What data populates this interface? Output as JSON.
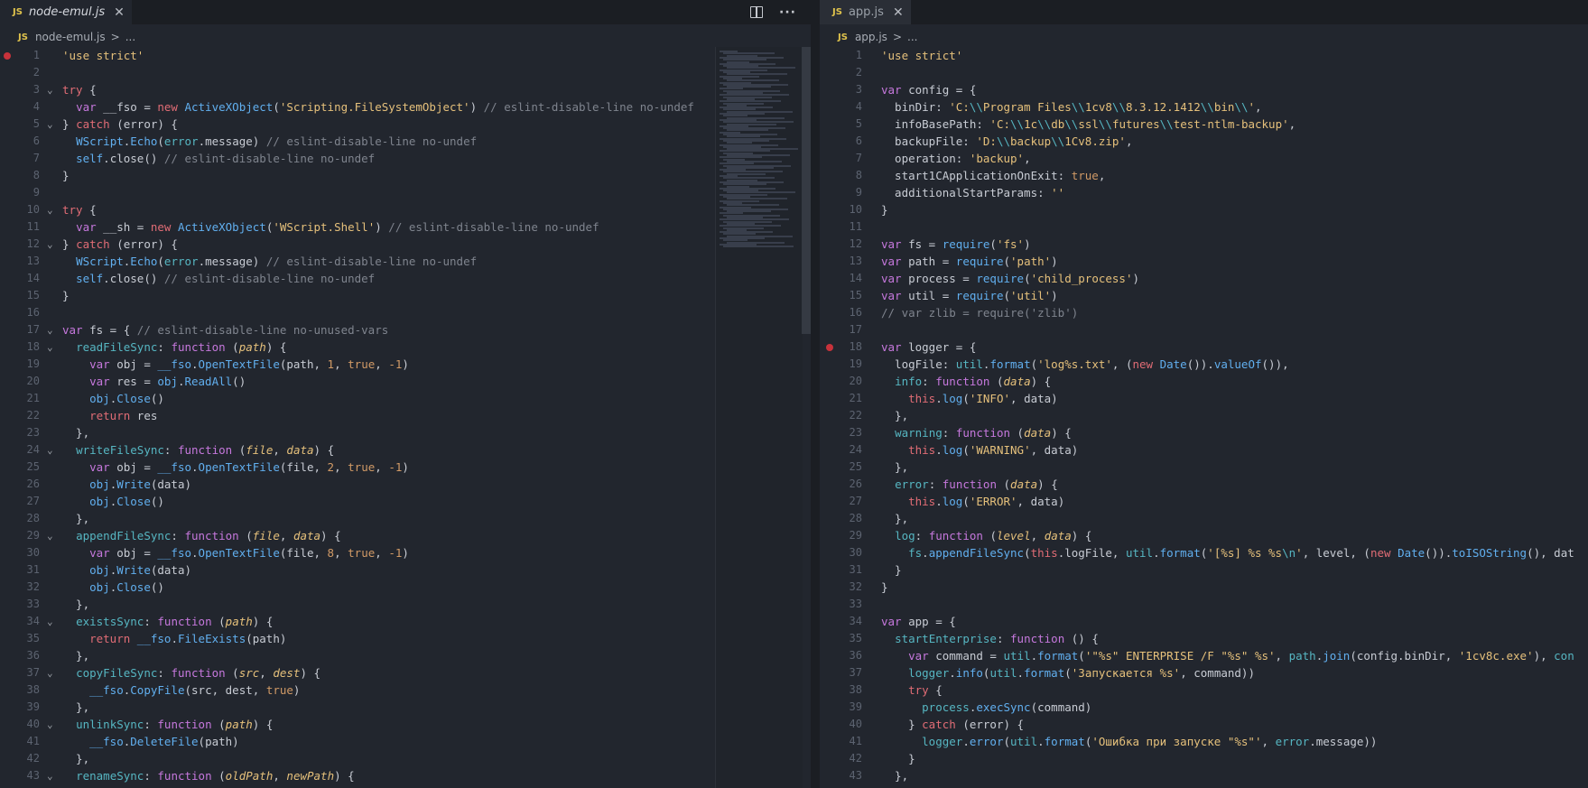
{
  "left": {
    "tab": {
      "badge": "JS",
      "name": "node-emul.js",
      "close": "✕"
    },
    "actions": {
      "more": "···"
    },
    "breadcrumb": {
      "badge": "JS",
      "file": "node-emul.js",
      "sep": ">",
      "rest": "..."
    }
  },
  "right": {
    "tab": {
      "badge": "JS",
      "name": "app.js",
      "close": "✕"
    },
    "breadcrumb": {
      "badge": "JS",
      "file": "app.js",
      "sep": ">",
      "rest": "..."
    }
  },
  "colors": {
    "breakpoint": "#c8323b",
    "accent_js": "#e0c34c",
    "background": "#22262e"
  },
  "left_lines": [
    {
      "n": "1",
      "bp": true,
      "h": "<span class='s'>'use strict'</span>"
    },
    {
      "n": "2",
      "h": ""
    },
    {
      "n": "3",
      "fold": true,
      "h": "<span class='kr'>try</span> {"
    },
    {
      "n": "4",
      "h": "  <span class='k'>var</span> __fso = <span class='kr'>new</span> <span class='f'>ActiveXObject</span>(<span class='s'>'Scripting.FileSystemObject'</span>) <span class='c'>// eslint-disable-line no-undef</span>"
    },
    {
      "n": "5",
      "fold": true,
      "h": "} <span class='kr'>catch</span> (error) {"
    },
    {
      "n": "6",
      "h": "  <span class='f'>WScript</span>.<span class='f'>Echo</span>(<span class='cy'>error</span>.message) <span class='c'>// eslint-disable-line no-undef</span>"
    },
    {
      "n": "7",
      "h": "  <span class='f'>self</span>.close() <span class='c'>// eslint-disable-line no-undef</span>"
    },
    {
      "n": "8",
      "h": "}"
    },
    {
      "n": "9",
      "h": ""
    },
    {
      "n": "10",
      "fold": true,
      "h": "<span class='kr'>try</span> {"
    },
    {
      "n": "11",
      "h": "  <span class='k'>var</span> __sh = <span class='kr'>new</span> <span class='f'>ActiveXObject</span>(<span class='s'>'WScript.Shell'</span>) <span class='c'>// eslint-disable-line no-undef</span>"
    },
    {
      "n": "12",
      "fold": true,
      "h": "} <span class='kr'>catch</span> (error) {"
    },
    {
      "n": "13",
      "h": "  <span class='f'>WScript</span>.<span class='f'>Echo</span>(<span class='cy'>error</span>.message) <span class='c'>// eslint-disable-line no-undef</span>"
    },
    {
      "n": "14",
      "h": "  <span class='f'>self</span>.close() <span class='c'>// eslint-disable-line no-undef</span>"
    },
    {
      "n": "15",
      "h": "}"
    },
    {
      "n": "16",
      "h": ""
    },
    {
      "n": "17",
      "fold": true,
      "h": "<span class='k'>var</span> fs = { <span class='c'>// eslint-disable-line no-unused-vars</span>"
    },
    {
      "n": "18",
      "fold": true,
      "h": "  <span class='cy'>readFileSync</span>: <span class='k'>function</span> (<span class='p'>path</span>) {"
    },
    {
      "n": "19",
      "h": "    <span class='k'>var</span> obj = <span class='f'>__fso</span>.<span class='f'>OpenTextFile</span>(path, <span class='n'>1</span>, <span class='n'>true</span>, <span class='n'>-1</span>)"
    },
    {
      "n": "20",
      "h": "    <span class='k'>var</span> res = <span class='f'>obj</span>.<span class='f'>ReadAll</span>()"
    },
    {
      "n": "21",
      "h": "    <span class='f'>obj</span>.<span class='f'>Close</span>()"
    },
    {
      "n": "22",
      "h": "    <span class='kr'>return</span> res"
    },
    {
      "n": "23",
      "h": "  },"
    },
    {
      "n": "24",
      "fold": true,
      "h": "  <span class='cy'>writeFileSync</span>: <span class='k'>function</span> (<span class='p'>file</span>, <span class='p'>data</span>) {"
    },
    {
      "n": "25",
      "h": "    <span class='k'>var</span> obj = <span class='f'>__fso</span>.<span class='f'>OpenTextFile</span>(file, <span class='n'>2</span>, <span class='n'>true</span>, <span class='n'>-1</span>)"
    },
    {
      "n": "26",
      "h": "    <span class='f'>obj</span>.<span class='f'>Write</span>(data)"
    },
    {
      "n": "27",
      "h": "    <span class='f'>obj</span>.<span class='f'>Close</span>()"
    },
    {
      "n": "28",
      "h": "  },"
    },
    {
      "n": "29",
      "fold": true,
      "h": "  <span class='cy'>appendFileSync</span>: <span class='k'>function</span> (<span class='p'>file</span>, <span class='p'>data</span>) {"
    },
    {
      "n": "30",
      "h": "    <span class='k'>var</span> obj = <span class='f'>__fso</span>.<span class='f'>OpenTextFile</span>(file, <span class='n'>8</span>, <span class='n'>true</span>, <span class='n'>-1</span>)"
    },
    {
      "n": "31",
      "h": "    <span class='f'>obj</span>.<span class='f'>Write</span>(data)"
    },
    {
      "n": "32",
      "h": "    <span class='f'>obj</span>.<span class='f'>Close</span>()"
    },
    {
      "n": "33",
      "h": "  },"
    },
    {
      "n": "34",
      "fold": true,
      "h": "  <span class='cy'>existsSync</span>: <span class='k'>function</span> (<span class='p'>path</span>) {"
    },
    {
      "n": "35",
      "h": "    <span class='kr'>return</span> <span class='f'>__fso</span>.<span class='f'>FileExists</span>(path)"
    },
    {
      "n": "36",
      "h": "  },"
    },
    {
      "n": "37",
      "fold": true,
      "h": "  <span class='cy'>copyFileSync</span>: <span class='k'>function</span> (<span class='p'>src</span>, <span class='p'>dest</span>) {"
    },
    {
      "n": "38",
      "h": "    <span class='f'>__fso</span>.<span class='f'>CopyFile</span>(src, dest, <span class='n'>true</span>)"
    },
    {
      "n": "39",
      "h": "  },"
    },
    {
      "n": "40",
      "fold": true,
      "h": "  <span class='cy'>unlinkSync</span>: <span class='k'>function</span> (<span class='p'>path</span>) {"
    },
    {
      "n": "41",
      "h": "    <span class='f'>__fso</span>.<span class='f'>DeleteFile</span>(path)"
    },
    {
      "n": "42",
      "h": "  },"
    },
    {
      "n": "43",
      "fold": true,
      "h": "  <span class='cy'>renameSync</span>: <span class='k'>function</span> (<span class='p'>oldPath</span>, <span class='p'>newPath</span>) {"
    }
  ],
  "right_lines": [
    {
      "n": "1",
      "h": "<span class='s'>'use strict'</span>"
    },
    {
      "n": "2",
      "h": ""
    },
    {
      "n": "3",
      "h": "<span class='k'>var</span> config = {"
    },
    {
      "n": "4",
      "h": "  binDir: <span class='s'>'C:</span><span class='cy'>\\\\</span><span class='s'>Program Files</span><span class='cy'>\\\\</span><span class='s'>1cv8</span><span class='cy'>\\\\</span><span class='s'>8.3.12.1412</span><span class='cy'>\\\\</span><span class='s'>bin</span><span class='cy'>\\\\</span><span class='s'>'</span>,"
    },
    {
      "n": "5",
      "h": "  infoBasePath: <span class='s'>'C:</span><span class='cy'>\\\\</span><span class='s'>1c</span><span class='cy'>\\\\</span><span class='s'>db</span><span class='cy'>\\\\</span><span class='s'>ssl</span><span class='cy'>\\\\</span><span class='s'>futures</span><span class='cy'>\\\\</span><span class='s'>test-ntlm-backup'</span>,"
    },
    {
      "n": "6",
      "h": "  backupFile: <span class='s'>'D:</span><span class='cy'>\\\\</span><span class='s'>backup</span><span class='cy'>\\\\</span><span class='s'>1Cv8.zip'</span>,"
    },
    {
      "n": "7",
      "h": "  operation: <span class='s'>'backup'</span>,"
    },
    {
      "n": "8",
      "h": "  start1CApplicationOnExit: <span class='n'>true</span>,"
    },
    {
      "n": "9",
      "h": "  additionalStartParams: <span class='s'>''</span>"
    },
    {
      "n": "10",
      "h": "}"
    },
    {
      "n": "11",
      "h": ""
    },
    {
      "n": "12",
      "h": "<span class='k'>var</span> fs = <span class='f'>require</span>(<span class='s'>'fs'</span>)"
    },
    {
      "n": "13",
      "h": "<span class='k'>var</span> path = <span class='f'>require</span>(<span class='s'>'path'</span>)"
    },
    {
      "n": "14",
      "h": "<span class='k'>var</span> process = <span class='f'>require</span>(<span class='s'>'child_process'</span>)"
    },
    {
      "n": "15",
      "h": "<span class='k'>var</span> util = <span class='f'>require</span>(<span class='s'>'util'</span>)"
    },
    {
      "n": "16",
      "h": "<span class='c'>// var zlib = require('zlib')</span>"
    },
    {
      "n": "17",
      "h": ""
    },
    {
      "n": "18",
      "bp": true,
      "h": "<span class='k'>var</span> logger = {"
    },
    {
      "n": "19",
      "h": "  logFile: <span class='cy'>util</span>.<span class='f'>format</span>(<span class='s'>'log%s.txt'</span>, (<span class='kr'>new</span> <span class='f'>Date</span>()).<span class='f'>valueOf</span>()),"
    },
    {
      "n": "20",
      "h": "  <span class='cy'>info</span>: <span class='k'>function</span> (<span class='p'>data</span>) {"
    },
    {
      "n": "21",
      "h": "    <span class='kr'>this</span>.<span class='f'>log</span>(<span class='s'>'INFO'</span>, data)"
    },
    {
      "n": "22",
      "h": "  },"
    },
    {
      "n": "23",
      "h": "  <span class='cy'>warning</span>: <span class='k'>function</span> (<span class='p'>data</span>) {"
    },
    {
      "n": "24",
      "h": "    <span class='kr'>this</span>.<span class='f'>log</span>(<span class='s'>'WARNING'</span>, data)"
    },
    {
      "n": "25",
      "h": "  },"
    },
    {
      "n": "26",
      "h": "  <span class='cy'>error</span>: <span class='k'>function</span> (<span class='p'>data</span>) {"
    },
    {
      "n": "27",
      "h": "    <span class='kr'>this</span>.<span class='f'>log</span>(<span class='s'>'ERROR'</span>, data)"
    },
    {
      "n": "28",
      "h": "  },"
    },
    {
      "n": "29",
      "h": "  <span class='cy'>log</span>: <span class='k'>function</span> (<span class='p'>level</span>, <span class='p'>data</span>) {"
    },
    {
      "n": "30",
      "h": "    <span class='cy'>fs</span>.<span class='f'>appendFileSync</span>(<span class='kr'>this</span>.logFile, <span class='cy'>util</span>.<span class='f'>format</span>(<span class='s'>'[%s] %s %s</span><span class='cy'>\\n</span><span class='s'>'</span>, level, (<span class='kr'>new</span> <span class='f'>Date</span>()).<span class='f'>toISOString</span>(), dat"
    },
    {
      "n": "31",
      "h": "  }"
    },
    {
      "n": "32",
      "h": "}"
    },
    {
      "n": "33",
      "h": ""
    },
    {
      "n": "34",
      "h": "<span class='k'>var</span> app = {"
    },
    {
      "n": "35",
      "h": "  <span class='cy'>startEnterprise</span>: <span class='k'>function</span> () {"
    },
    {
      "n": "36",
      "h": "    <span class='k'>var</span> command = <span class='cy'>util</span>.<span class='f'>format</span>(<span class='s'>'\"%s\" ENTERPRISE /F \"%s\" %s'</span>, <span class='cy'>path</span>.<span class='f'>join</span>(config.binDir, <span class='s'>'1cv8c.exe'</span>), <span class='cy'>con</span>"
    },
    {
      "n": "37",
      "h": "    <span class='cy'>logger</span>.<span class='f'>info</span>(<span class='cy'>util</span>.<span class='f'>format</span>(<span class='s'>'Запускается %s'</span>, command))"
    },
    {
      "n": "38",
      "h": "    <span class='kr'>try</span> {"
    },
    {
      "n": "39",
      "h": "      <span class='cy'>process</span>.<span class='f'>execSync</span>(command)"
    },
    {
      "n": "40",
      "h": "    } <span class='kr'>catch</span> (error) {"
    },
    {
      "n": "41",
      "h": "      <span class='cy'>logger</span>.<span class='f'>error</span>(<span class='cy'>util</span>.<span class='f'>format</span>(<span class='s'>'Ошибка при запуске \"%s\"'</span>, <span class='cy'>error</span>.message))"
    },
    {
      "n": "42",
      "h": "    }"
    },
    {
      "n": "43",
      "h": "  },"
    }
  ]
}
